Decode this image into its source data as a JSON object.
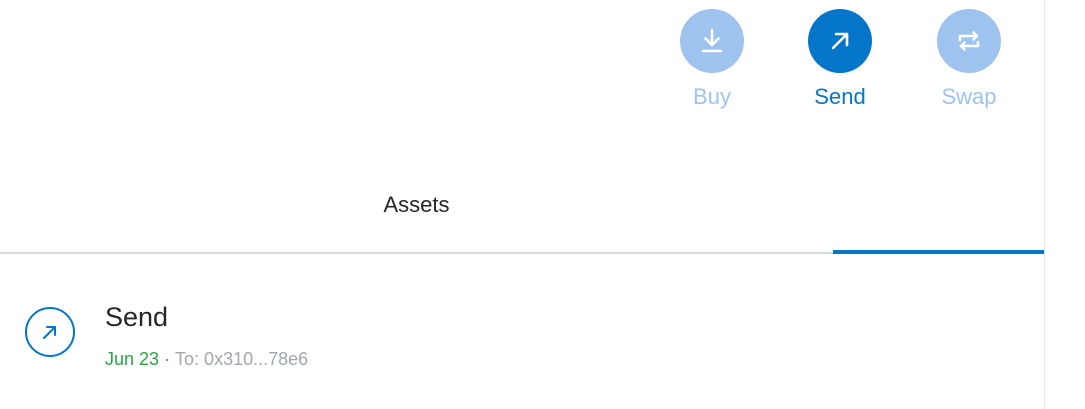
{
  "colors": {
    "accent": "#0376c9",
    "accent_disabled": "#9dc3ee",
    "success": "#28a745",
    "muted_text": "#a1a7ae",
    "primary_text": "#24272a",
    "divider": "#d6d9dc"
  },
  "actions": [
    {
      "label": "Buy",
      "icon": "download-arrow-icon",
      "state": "disabled"
    },
    {
      "label": "Send",
      "icon": "arrow-up-right-icon",
      "state": "active"
    },
    {
      "label": "Swap",
      "icon": "swap-arrows-icon",
      "state": "disabled"
    }
  ],
  "tabs": [
    {
      "label": "Assets",
      "selected": false
    },
    {
      "label": "",
      "selected": true
    }
  ],
  "activity": [
    {
      "title": "Send",
      "icon": "arrow-up-right-icon",
      "date": "Jun 23",
      "separator": "·",
      "to": "To: 0x310...78e6"
    }
  ]
}
